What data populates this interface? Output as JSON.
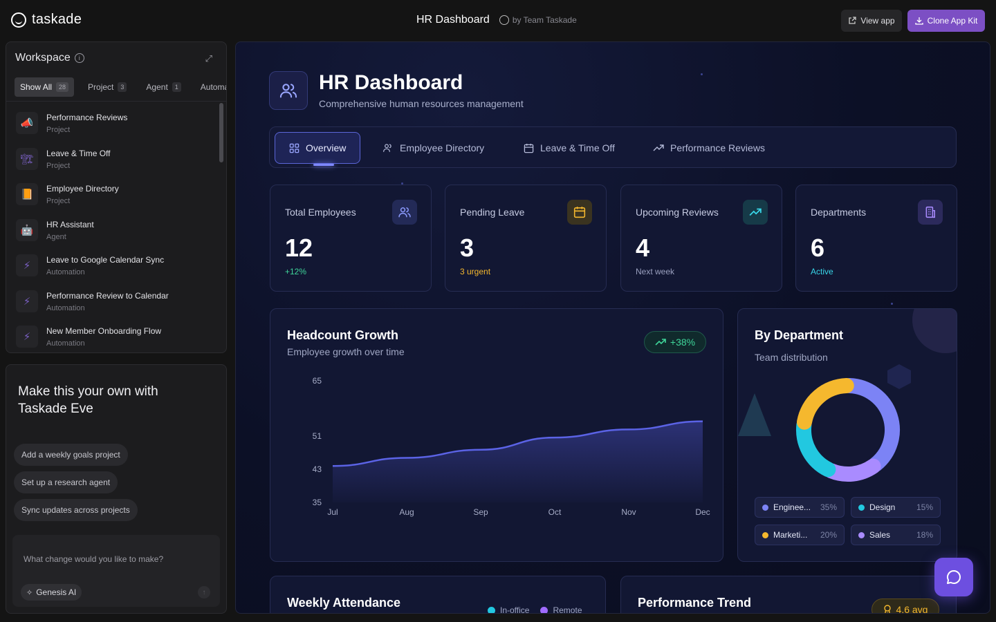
{
  "topbar": {
    "logo_text": "taskade",
    "app_title": "HR Dashboard",
    "by_text": "by Team Taskade",
    "view_app": "View app",
    "clone_app": "Clone App Kit"
  },
  "workspace": {
    "title": "Workspace",
    "tabs": [
      {
        "label": "Show All",
        "count": "28"
      },
      {
        "label": "Project",
        "count": "3"
      },
      {
        "label": "Agent",
        "count": "1"
      },
      {
        "label": "Automation",
        "count": ""
      }
    ],
    "items": [
      {
        "name": "Performance Reviews",
        "type": "Project",
        "icon": "📣"
      },
      {
        "name": "Leave & Time Off",
        "type": "Project",
        "icon": "🏗"
      },
      {
        "name": "Employee Directory",
        "type": "Project",
        "icon": "📙"
      },
      {
        "name": "HR Assistant",
        "type": "Agent",
        "icon": "🤖"
      },
      {
        "name": "Leave to Google Calendar Sync",
        "type": "Automation",
        "icon": "⚡"
      },
      {
        "name": "Performance Review to Calendar",
        "type": "Automation",
        "icon": "⚡"
      },
      {
        "name": "New Member Onboarding Flow",
        "type": "Automation",
        "icon": "⚡"
      }
    ]
  },
  "eve": {
    "title": "Make this your own with Taskade Eve",
    "suggestions": [
      "Add a weekly goals project",
      "Set up a research agent",
      "Sync updates across projects"
    ],
    "input_placeholder": "What change would you like to make?",
    "model": "Genesis AI"
  },
  "main": {
    "title": "HR Dashboard",
    "subtitle": "Comprehensive human resources management",
    "tabs": [
      {
        "label": "Overview",
        "icon": "grid-icon"
      },
      {
        "label": "Employee Directory",
        "icon": "users-icon"
      },
      {
        "label": "Leave & Time Off",
        "icon": "calendar-icon"
      },
      {
        "label": "Performance Reviews",
        "icon": "trending-up-icon"
      }
    ],
    "stats": [
      {
        "label": "Total Employees",
        "value": "12",
        "sub": "+12%",
        "sub_color": "#3fd69a",
        "icon": "users-icon",
        "icon_color": "#8c9bff"
      },
      {
        "label": "Pending Leave",
        "value": "3",
        "sub": "3 urgent",
        "sub_color": "#f5b82e",
        "icon": "calendar-icon",
        "icon_color": "#f5b82e"
      },
      {
        "label": "Upcoming Reviews",
        "value": "4",
        "sub": "Next week",
        "sub_color": "#9aa0bf",
        "icon": "trending-up-icon",
        "icon_color": "#38d6e8"
      },
      {
        "label": "Departments",
        "value": "6",
        "sub": "Active",
        "sub_color": "#38d6e8",
        "icon": "building-icon",
        "icon_color": "#a98bff"
      }
    ],
    "headcount": {
      "title": "Headcount Growth",
      "subtitle": "Employee growth over time",
      "badge": "+38%"
    },
    "department": {
      "title": "By Department",
      "subtitle": "Team distribution"
    },
    "attendance": {
      "title": "Weekly Attendance",
      "legend": [
        "In-office",
        "Remote"
      ]
    },
    "performance": {
      "title": "Performance Trend",
      "badge": "4.6 avg"
    }
  },
  "chart_data": [
    {
      "type": "area",
      "title": "Headcount Growth",
      "categories": [
        "Jul",
        "Aug",
        "Sep",
        "Oct",
        "Nov",
        "Dec"
      ],
      "values": [
        44,
        46,
        48,
        51,
        53,
        55
      ],
      "yticks": [
        "65",
        "51",
        "43",
        "35"
      ],
      "ylim": [
        35,
        65
      ],
      "color": "#5b63e6"
    },
    {
      "type": "pie",
      "title": "By Department",
      "slices": [
        {
          "name": "Enginee...",
          "pct": "35%",
          "value": 35,
          "color": "#7c83f5"
        },
        {
          "name": "Design",
          "pct": "15%",
          "value": 15,
          "color": "#a98bff"
        },
        {
          "name": "Marketi...",
          "pct": "20%",
          "value": 20,
          "color": "#f5b82e"
        },
        {
          "name": "Sales",
          "pct": "18%",
          "value": 18,
          "color": "#22c8e0"
        }
      ]
    }
  ]
}
